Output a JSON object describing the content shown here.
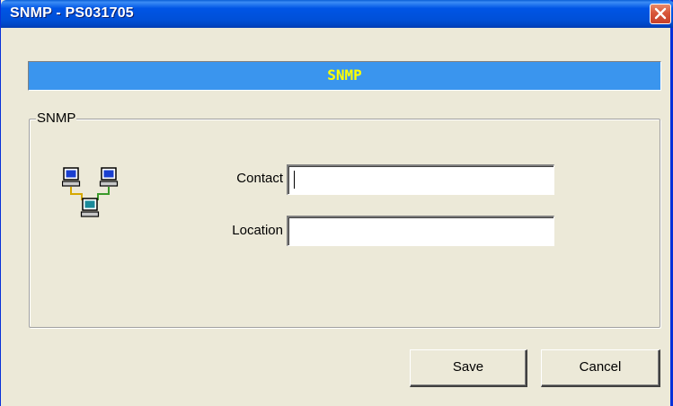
{
  "window": {
    "title": "SNMP - PS031705"
  },
  "banner": {
    "text": "SNMP"
  },
  "group": {
    "label": "SNMP",
    "icon": "network-computers-icon"
  },
  "fields": {
    "contact": {
      "label": "Contact",
      "value": ""
    },
    "location": {
      "label": "Location",
      "value": ""
    }
  },
  "buttons": {
    "save": "Save",
    "cancel": "Cancel"
  },
  "colors": {
    "titlebar": "#0055e5",
    "banner": "#3a95ee",
    "banner_text": "#ffff00",
    "dialog_bg": "#ece9d8",
    "close_button": "#d8563a"
  }
}
